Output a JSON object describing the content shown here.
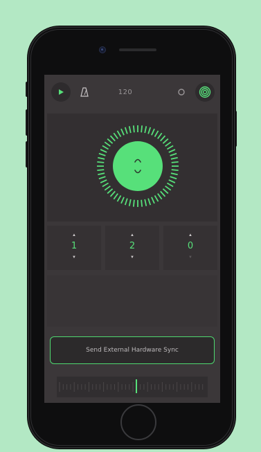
{
  "toolbar": {
    "play_icon": "play-icon",
    "metronome_icon": "metronome-icon",
    "bpm": "120",
    "record_icon": "circle-icon",
    "target_icon": "target-icon"
  },
  "dial": {
    "top_glyph": "^",
    "bottom_glyph": "v"
  },
  "counters": [
    {
      "value": "1"
    },
    {
      "value": "2"
    },
    {
      "value": "0"
    }
  ],
  "sync_button": {
    "label": "Send External Hardware Sync"
  },
  "colors": {
    "accent": "#57e07a",
    "background": "#b3e8c4",
    "screen": "#3b3739"
  }
}
